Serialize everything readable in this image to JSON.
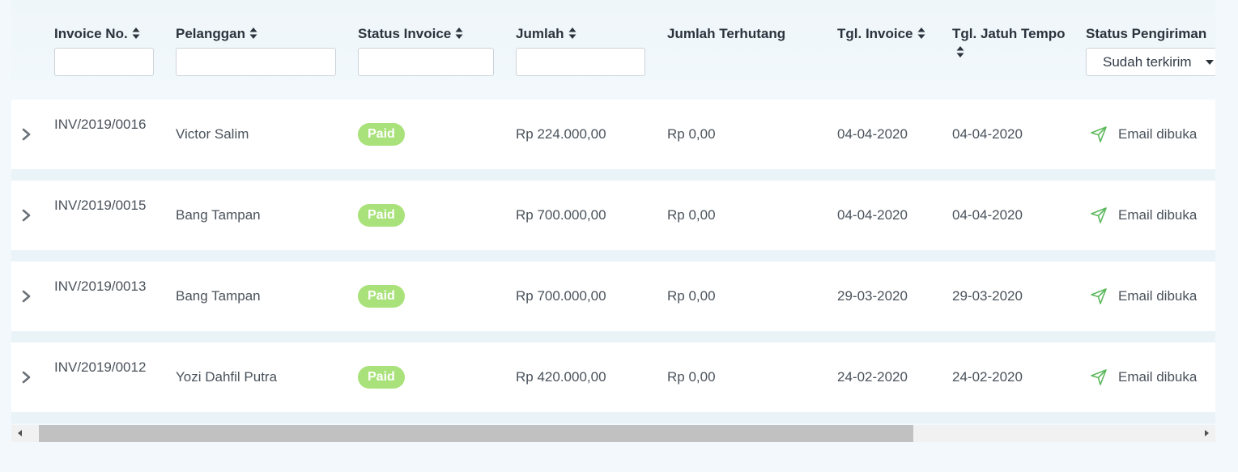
{
  "columns": {
    "invoice_no": "Invoice No.",
    "pelanggan": "Pelanggan",
    "status_invoice": "Status Invoice",
    "jumlah": "Jumlah",
    "jumlah_terhutang": "Jumlah Terhutang",
    "tgl_invoice": "Tgl. Invoice",
    "tgl_jatuh_tempo": "Tgl. Jatuh Tempo",
    "status_pengiriman": "Status Pengiriman"
  },
  "filters": {
    "invoice_no": "",
    "pelanggan": "",
    "status_invoice": "",
    "jumlah": "",
    "status_pengiriman_selected": "Sudah terkirim"
  },
  "icons": {
    "sort": "sort-icon",
    "expand": "chevron-right-icon",
    "dropdown": "caret-down-icon",
    "status": "send-icon"
  },
  "colors": {
    "paid_badge": "#a9e27a",
    "send_icon": "#5cb85c"
  },
  "rows": [
    {
      "invoice_no": "INV/2019/0016",
      "pelanggan": "Victor Salim",
      "status": "Paid",
      "jumlah": "Rp 224.000,00",
      "terhutang": "Rp 0,00",
      "tgl_invoice": "04-04-2020",
      "jatuh_tempo": "04-04-2020",
      "pengiriman": "Email dibuka"
    },
    {
      "invoice_no": "INV/2019/0015",
      "pelanggan": "Bang Tampan",
      "status": "Paid",
      "jumlah": "Rp 700.000,00",
      "terhutang": "Rp 0,00",
      "tgl_invoice": "04-04-2020",
      "jatuh_tempo": "04-04-2020",
      "pengiriman": "Email dibuka"
    },
    {
      "invoice_no": "INV/2019/0013",
      "pelanggan": "Bang Tampan",
      "status": "Paid",
      "jumlah": "Rp 700.000,00",
      "terhutang": "Rp 0,00",
      "tgl_invoice": "29-03-2020",
      "jatuh_tempo": "29-03-2020",
      "pengiriman": "Email dibuka"
    },
    {
      "invoice_no": "INV/2019/0012",
      "pelanggan": "Yozi Dahfil Putra",
      "status": "Paid",
      "jumlah": "Rp 420.000,00",
      "terhutang": "Rp 0,00",
      "tgl_invoice": "24-02-2020",
      "jatuh_tempo": "24-02-2020",
      "pengiriman": "Email dibuka"
    }
  ]
}
